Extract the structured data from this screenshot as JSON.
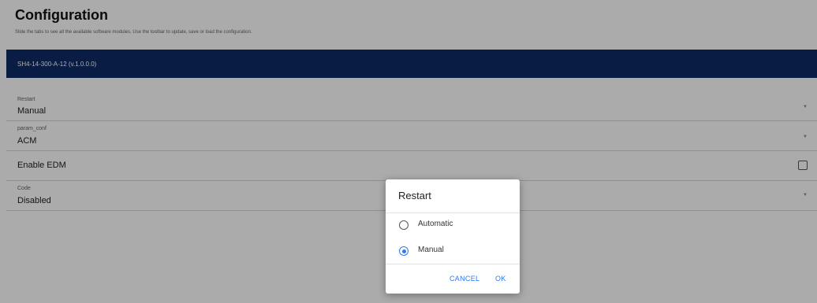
{
  "page": {
    "title": "Configuration",
    "subtitle": "Slide the tabs to see all the available software modules. Use the toolbar to update, save or load the configuration."
  },
  "module": {
    "label": "SH4-14-300-A-12 (v.1.0.0.0)"
  },
  "config": {
    "restart": {
      "label": "Restart",
      "value": "Manual"
    },
    "param_conf": {
      "label": "param_conf",
      "value": "ACM"
    },
    "enable_edm": {
      "label": "Enable EDM",
      "checked": false
    },
    "code": {
      "label": "Code",
      "value": "Disabled"
    }
  },
  "dialog": {
    "title": "Restart",
    "options": [
      {
        "label": "Automatic",
        "selected": false
      },
      {
        "label": "Manual",
        "selected": true
      }
    ],
    "cancel_label": "CANCEL",
    "ok_label": "OK"
  },
  "colors": {
    "header_bar": "#0d2a66",
    "accent": "#2d78f0"
  },
  "icons": {
    "dropdown": "chevron-down-icon",
    "checkbox": "checkbox-icon"
  }
}
